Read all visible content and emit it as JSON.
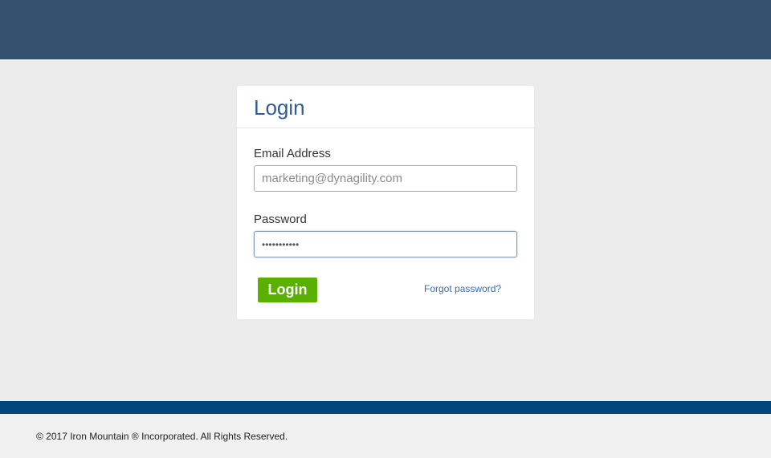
{
  "login_card": {
    "title": "Login",
    "email_label": "Email Address",
    "email_placeholder": "marketing@dynagility.com",
    "password_label": "Password",
    "password_value": "•••••••••••",
    "login_button_label": "Login",
    "forgot_password_label": "Forgot password?"
  },
  "footer": {
    "copyright": "© 2017 Iron Mountain ® Incorporated. All Rights Reserved."
  },
  "colors": {
    "header": "#354f6e",
    "accent_button": "#5ab000",
    "footer_bar": "#00467f",
    "title": "#2e5d95"
  }
}
